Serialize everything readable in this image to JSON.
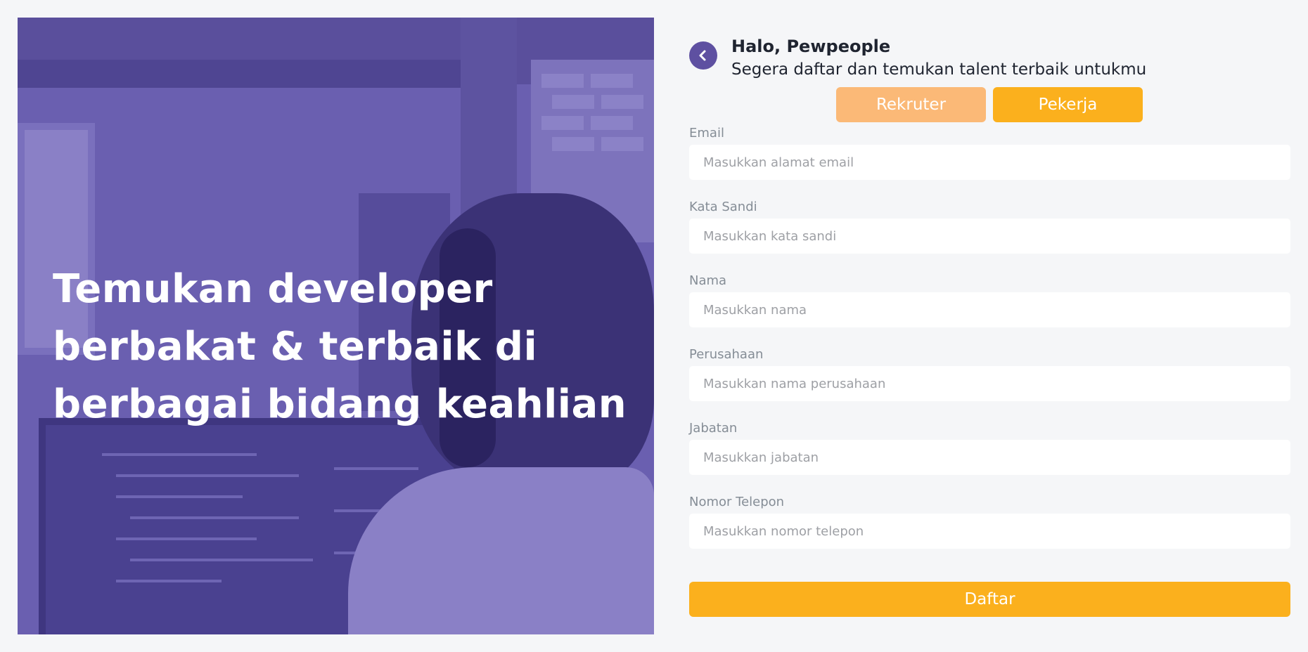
{
  "hero": {
    "headline": "Temukan developer berbakat & terbaik di berbagai bidang keahlian"
  },
  "header": {
    "greeting": "Halo, Pewpeople",
    "subtitle": "Segera daftar dan temukan talent terbaik untukmu",
    "back_icon": "chevron-left-icon"
  },
  "roles": {
    "rekruter": "Rekruter",
    "pekerja": "Pekerja"
  },
  "fields": [
    {
      "label": "Email",
      "placeholder": "Masukkan alamat email",
      "value": ""
    },
    {
      "label": "Kata Sandi",
      "placeholder": "Masukkan kata sandi",
      "value": ""
    },
    {
      "label": "Nama",
      "placeholder": "Masukkan nama",
      "value": ""
    },
    {
      "label": "Perusahaan",
      "placeholder": "Masukkan nama perusahaan",
      "value": ""
    },
    {
      "label": "Jabatan",
      "placeholder": "Masukkan jabatan",
      "value": ""
    },
    {
      "label": "Nomor Telepon",
      "placeholder": "Masukkan nomor telepon",
      "value": ""
    }
  ],
  "submit_label": "Daftar",
  "colors": {
    "primary": "#5e50a1",
    "accent": "#fbb01d",
    "accent_light": "#fbb977",
    "background": "#f5f6f8"
  }
}
